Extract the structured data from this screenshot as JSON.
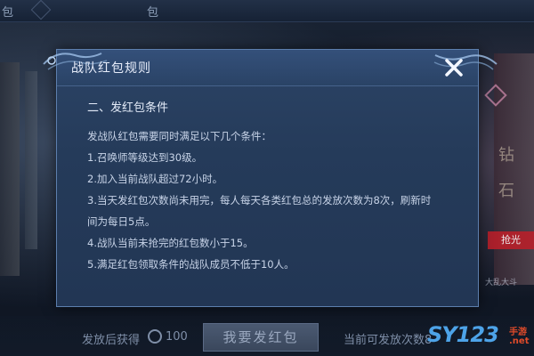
{
  "topbar": {
    "left_text": "包",
    "right_text": "包"
  },
  "background": {
    "right_chars": [
      "钻",
      "石"
    ],
    "red_tag": "抢光",
    "right_small": "大乱大斗"
  },
  "dialog": {
    "title": "战队红包规则",
    "heading": "二、发红包条件",
    "lines": [
      "发战队红包需要同时满足以下几个条件：",
      "1.召唤师等级达到30级。",
      "2.加入当前战队超过72小时。",
      "3.当天发红包次数尚未用完，每人每天各类红包总的发放次数为8次，刷新时",
      "间为每日5点。",
      "4.战队当前未抢完的红包数小于15。",
      "5.满足红包领取条件的战队成员不低于10人。"
    ]
  },
  "bottom": {
    "reward_label": "发放后获得",
    "reward_value": "100",
    "send_button": "我要发红包",
    "remaining_label": "当前可发放次数8"
  },
  "watermark": {
    "main": "SY123",
    "sub1": "手游",
    "sub2": ".net"
  },
  "colors": {
    "dialog_bg": "#253b5a",
    "dialog_border": "#5d7fae",
    "accent_blue": "#4da3e8",
    "red": "#b8202a"
  }
}
